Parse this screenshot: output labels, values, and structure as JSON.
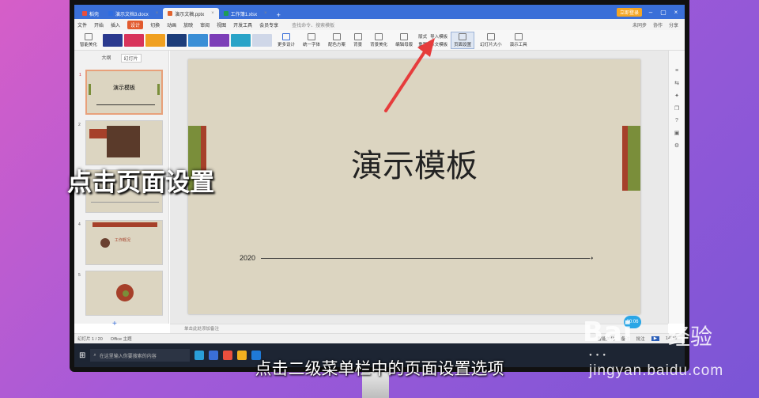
{
  "tabs": [
    {
      "label": "稻壳",
      "color": "#e94f3d"
    },
    {
      "label": "演示文档3.docx",
      "color": "#2f6de0"
    },
    {
      "label": "演示文稿.pptx",
      "color": "#e2632e",
      "active": true
    },
    {
      "label": "工作簿1.xlsx",
      "color": "#1f9d55"
    }
  ],
  "titlebar": {
    "login": "立即登录",
    "add": "+"
  },
  "menu": {
    "items": [
      "文件",
      "开始",
      "插入",
      "设计",
      "切换",
      "动画",
      "放映",
      "审阅",
      "视图",
      "开发工具",
      "会员专享"
    ],
    "active": "设计",
    "search": "查找命令、搜索模板",
    "right": [
      "未同步",
      "协作",
      "分享"
    ]
  },
  "ribbon": {
    "smart_beautify": "智能美化",
    "more_design": "更多设计",
    "unify_font": "统一字体",
    "color_scheme": "配色方案",
    "background": "背景",
    "bg_fill": "背景美化",
    "edit_master": "编辑母版",
    "format": "版式",
    "reset": "重置",
    "import_template": "导入模板",
    "text_template": "本文模板",
    "page_setup": "页面设置",
    "slide_size": "幻灯片大小",
    "tools": "演示工具"
  },
  "leftpanel": {
    "tabs": [
      "大纲",
      "幻灯片"
    ],
    "active": "幻灯片",
    "add": "+",
    "thumb_titles": [
      "演示模板",
      "",
      "",
      "工作概况",
      "",
      ""
    ]
  },
  "slide": {
    "title": "演示模板",
    "year": "2020"
  },
  "notes": {
    "placeholder": "单击此处添加备注"
  },
  "status": {
    "slide": "幻灯片 1 / 20",
    "theme": "Office 主题",
    "beautify": "智能美化",
    "notes": "备注",
    "comment": "批注",
    "zoom": "147%"
  },
  "taskbar": {
    "search": "在这里输入你要搜索的内容"
  },
  "timer": "00:06",
  "overlay": {
    "caption": "点击页面设置",
    "subtitle": "点击二级菜单栏中的页面设置选项"
  },
  "watermark": {
    "logo": "Bai",
    "text": "经验",
    "url": "jingyan.baidu.com"
  },
  "colors": {
    "accent": "#e25b2f",
    "slide_bg": "#dcd5c1",
    "green_bar": "#7a8e3a",
    "red_bar": "#a6402a",
    "arrow": "#e63c3c"
  }
}
